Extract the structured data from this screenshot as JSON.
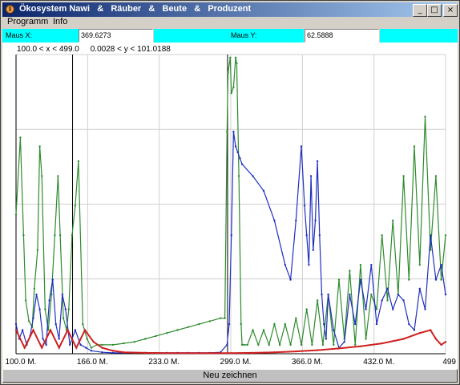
{
  "window": {
    "title": "Ökosystem Nawi   &   Räuber   &   Beute   &   Produzent",
    "controls": {
      "minimize": "_",
      "maximize": "□",
      "close": "×"
    }
  },
  "menu": {
    "items": [
      "Programm",
      "Info"
    ]
  },
  "coords": {
    "x_label": "Maus X:",
    "x_value": "369.6273",
    "y_label": "Maus Y:",
    "y_value": "62.5888",
    "accent": "#00ffff"
  },
  "plot": {
    "range_text": "100.0 < x < 499.0     0.0028 < y < 101.0188"
  },
  "chart_data": {
    "type": "line",
    "xlim": [
      100.0,
      499.0
    ],
    "ylim": [
      0.0028,
      101.0188
    ],
    "x_ticks": [
      "100.0 M.",
      "166.0 M.",
      "233.0 M.",
      "299.0 M.",
      "366.0 M.",
      "432.0 M.",
      "499"
    ],
    "grid": true,
    "markers": [
      {
        "x": 152.5,
        "color": "#000000"
      },
      {
        "x": 296.5,
        "color": "#000000"
      }
    ],
    "series": [
      {
        "color": "#2e8b2e",
        "x": [
          100,
          104,
          107,
          109,
          112,
          115,
          117,
          120,
          122,
          124,
          127,
          130,
          133,
          136,
          139,
          141,
          144,
          147,
          149,
          152,
          155,
          158,
          162,
          166,
          170,
          175,
          180,
          190,
          200,
          210,
          220,
          230,
          240,
          250,
          260,
          270,
          280,
          290,
          294,
          296,
          297,
          299,
          300,
          302,
          304,
          305,
          307,
          309,
          310,
          312,
          315,
          320,
          325,
          330,
          335,
          340,
          345,
          350,
          355,
          360,
          365,
          370,
          375,
          380,
          385,
          390,
          395,
          400,
          405,
          410,
          415,
          420,
          425,
          430,
          435,
          440,
          445,
          450,
          455,
          460,
          465,
          470,
          475,
          480,
          485,
          490,
          495,
          499
        ],
        "y": [
          47,
          73,
          40,
          18,
          11,
          9,
          22,
          35,
          70,
          60,
          15,
          8,
          20,
          40,
          60,
          40,
          12,
          8,
          15,
          40,
          50,
          65,
          10,
          5,
          2,
          3,
          3,
          3,
          3.5,
          4,
          5,
          6,
          7,
          8,
          9,
          10,
          11,
          12,
          12,
          75,
          95,
          100,
          88,
          90,
          100,
          98,
          60,
          10,
          3,
          3,
          3,
          8,
          3,
          8,
          3,
          10,
          3,
          10,
          3,
          12,
          3,
          15,
          3,
          18,
          3,
          20,
          3,
          25,
          5,
          28,
          3,
          30,
          5,
          20,
          15,
          40,
          18,
          45,
          20,
          60,
          25,
          70,
          30,
          80,
          35,
          60,
          25,
          40
        ]
      },
      {
        "color": "#1f2fbf",
        "x": [
          100,
          103,
          106,
          110,
          113,
          116,
          119,
          122,
          125,
          128,
          131,
          134,
          137,
          140,
          143,
          146,
          150,
          155,
          160,
          165,
          170,
          180,
          190,
          200,
          210,
          220,
          230,
          240,
          250,
          260,
          270,
          280,
          290,
          296,
          298,
          300,
          302,
          304,
          306,
          308,
          310,
          320,
          330,
          340,
          350,
          355,
          360,
          365,
          368,
          370,
          372,
          374,
          376,
          378,
          380,
          382,
          384,
          386,
          388,
          390,
          395,
          400,
          405,
          410,
          415,
          420,
          425,
          430,
          435,
          440,
          445,
          450,
          455,
          460,
          465,
          470,
          475,
          480,
          485,
          490,
          495,
          499
        ],
        "y": [
          10,
          5,
          8,
          3,
          6,
          12,
          20,
          15,
          5,
          3,
          18,
          25,
          10,
          5,
          20,
          15,
          3,
          8,
          3,
          2,
          1,
          0.5,
          0.3,
          0.3,
          0.3,
          0.3,
          0.3,
          0.3,
          0.3,
          0.3,
          0.3,
          0.3,
          0.5,
          3,
          10,
          40,
          75,
          70,
          68,
          66,
          64,
          60,
          55,
          45,
          30,
          25,
          45,
          70,
          50,
          40,
          30,
          60,
          35,
          45,
          65,
          40,
          20,
          10,
          5,
          20,
          8,
          2,
          4,
          20,
          10,
          25,
          15,
          30,
          10,
          18,
          22,
          15,
          20,
          18,
          10,
          8,
          22,
          15,
          40,
          25,
          30,
          20
        ]
      },
      {
        "color": "#d02020",
        "x": [
          100,
          108,
          116,
          124,
          132,
          140,
          148,
          156,
          164,
          172,
          180,
          190,
          200,
          220,
          240,
          260,
          280,
          300,
          320,
          340,
          360,
          380,
          400,
          420,
          440,
          460,
          475,
          485,
          490,
          495,
          499
        ],
        "y": [
          8,
          2,
          8,
          2,
          8,
          2,
          8,
          2,
          8,
          4,
          2,
          1,
          0.5,
          0.3,
          0.2,
          0.2,
          0.2,
          0.2,
          0.3,
          0.5,
          0.8,
          1.2,
          1.8,
          2.5,
          3.5,
          5,
          7,
          8,
          5,
          3,
          4
        ]
      }
    ]
  },
  "button": {
    "label": "Neu zeichnen"
  }
}
